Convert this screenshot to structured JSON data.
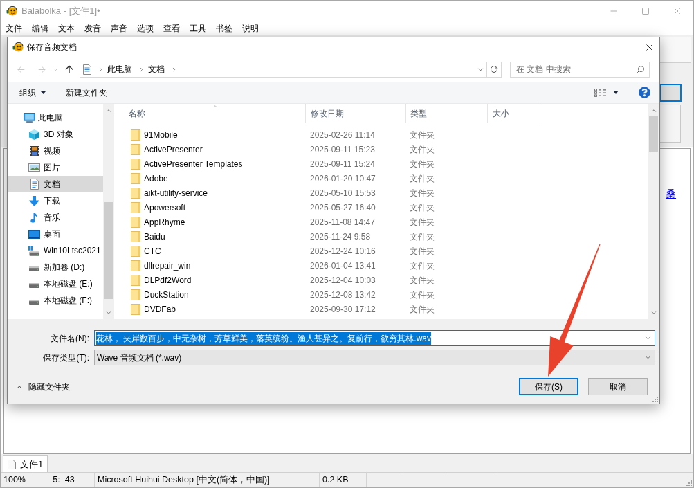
{
  "app": {
    "title": "Balabolka - [文件1]•",
    "menu": [
      "文件",
      "编辑",
      "文本",
      "发音",
      "声音",
      "选项",
      "查看",
      "工具",
      "书签",
      "说明"
    ]
  },
  "document": {
    "link_text": "桑"
  },
  "dialog": {
    "title": "保存音频文档",
    "back_disabled": true,
    "forward_disabled": true,
    "breadcrumb": [
      "此电脑",
      "文档"
    ],
    "search": {
      "placeholder": "在 文档 中搜索"
    },
    "toolbar": {
      "organize": "组织",
      "new_folder": "新建文件夹"
    },
    "nav": [
      {
        "label": "此电脑",
        "kind": "computer",
        "selected": false,
        "children": [
          {
            "label": "3D 对象",
            "kind": "cube",
            "selected": false
          },
          {
            "label": "视频",
            "kind": "film",
            "selected": false
          },
          {
            "label": "图片",
            "kind": "picture",
            "selected": false
          },
          {
            "label": "文档",
            "kind": "document",
            "selected": true
          },
          {
            "label": "下载",
            "kind": "download",
            "selected": false
          },
          {
            "label": "音乐",
            "kind": "music",
            "selected": false
          },
          {
            "label": "桌面",
            "kind": "desktop",
            "selected": false
          },
          {
            "label": "Win10Ltsc2021",
            "kind": "system-drive",
            "selected": false
          },
          {
            "label": "新加卷 (D:)",
            "kind": "drive",
            "selected": false
          },
          {
            "label": "本地磁盘 (E:)",
            "kind": "drive",
            "selected": false
          },
          {
            "label": "本地磁盘 (F:)",
            "kind": "drive",
            "selected": false
          }
        ]
      }
    ],
    "columns": [
      {
        "label": "名称",
        "sorted": true
      },
      {
        "label": "修改日期",
        "sorted": false
      },
      {
        "label": "类型",
        "sorted": false
      },
      {
        "label": "大小",
        "sorted": false
      }
    ],
    "files": [
      {
        "name": "91Mobile",
        "modified": "2025-02-26 11:14",
        "type": "文件夹",
        "selected": false
      },
      {
        "name": "ActivePresenter",
        "modified": "2025-09-11 15:23",
        "type": "文件夹",
        "selected": false
      },
      {
        "name": "ActivePresenter Templates",
        "modified": "2025-09-11 15:24",
        "type": "文件夹",
        "selected": false
      },
      {
        "name": "Adobe",
        "modified": "2026-01-20 10:47",
        "type": "文件夹",
        "selected": false
      },
      {
        "name": "aikt-utility-service",
        "modified": "2025-05-10 15:53",
        "type": "文件夹",
        "selected": false
      },
      {
        "name": "Apowersoft",
        "modified": "2025-05-27 16:40",
        "type": "文件夹",
        "selected": false
      },
      {
        "name": "AppRhyme",
        "modified": "2025-11-08 14:47",
        "type": "文件夹",
        "selected": false
      },
      {
        "name": "Baidu",
        "modified": "2025-11-24 9:58",
        "type": "文件夹",
        "selected": false
      },
      {
        "name": "CTC",
        "modified": "2025-12-24 10:16",
        "type": "文件夹",
        "selected": false
      },
      {
        "name": "dllrepair_win",
        "modified": "2026-01-04 13:41",
        "type": "文件夹",
        "selected": false
      },
      {
        "name": "DLPdf2Word",
        "modified": "2025-12-04 10:03",
        "type": "文件夹",
        "selected": false
      },
      {
        "name": "DuckStation",
        "modified": "2025-12-08 13:42",
        "type": "文件夹",
        "selected": false
      },
      {
        "name": "DVDFab",
        "modified": "2025-09-30 17:12",
        "type": "文件夹",
        "selected": false
      }
    ],
    "file_name": {
      "label": "文件名(N):",
      "value": "花林， 夹岸数百步，中无杂树，芳草鲜美，落英缤纷。渔人甚异之。复前行，欲穷其林.wav",
      "highlighted": true
    },
    "file_type": {
      "label": "保存类型(T):",
      "value": "Wave 音频文档 (*.wav)"
    },
    "hide_folders": "隐藏文件夹",
    "buttons": [
      {
        "label": "保存(S)",
        "default": true
      },
      {
        "label": "取消",
        "default": false
      }
    ]
  },
  "tabs": [
    {
      "label": "文件1",
      "selected": true
    }
  ],
  "status_bar": [
    "100%",
    "5:  43",
    "Microsoft Huihui Desktop [中文(简体，中国)]",
    "0.2 KB"
  ]
}
